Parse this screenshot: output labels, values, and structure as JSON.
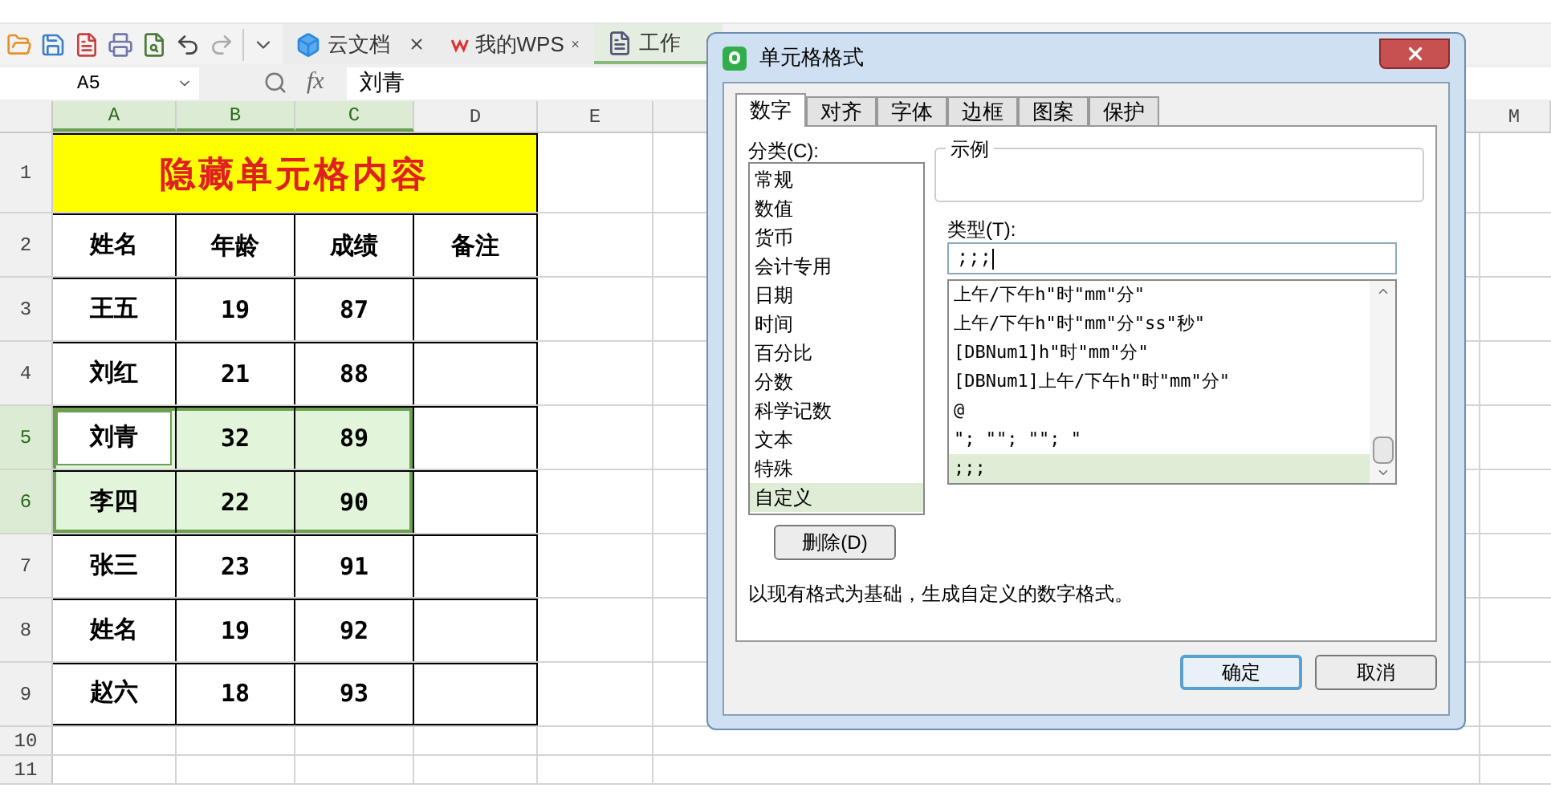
{
  "toolbar": {
    "tabs": [
      {
        "label": "云文档",
        "selected": false,
        "kind": "cloud",
        "closable": true
      },
      {
        "label": "我的WPS",
        "selected": false,
        "kind": "wps",
        "closable": true
      },
      {
        "label": "工作",
        "selected": true,
        "kind": "book",
        "closable": false
      }
    ]
  },
  "formula_bar": {
    "name_box": "A5",
    "fx_label": "fx",
    "value": "刘青"
  },
  "columns": [
    {
      "label": "A",
      "selected": true
    },
    {
      "label": "B",
      "selected": true
    },
    {
      "label": "C",
      "selected": true
    },
    {
      "label": "D",
      "selected": false
    },
    {
      "label": "E",
      "selected": false
    },
    {
      "label": "M",
      "selected": false
    }
  ],
  "rows": [
    {
      "label": "1",
      "selected": false,
      "kind": "title",
      "cells": [
        {
          "text": "隐藏单元格内容"
        }
      ]
    },
    {
      "label": "2",
      "selected": false,
      "kind": "table",
      "cells": [
        {
          "text": "姓名",
          "selected": false,
          "active": false
        },
        {
          "text": "年龄",
          "selected": false,
          "active": false
        },
        {
          "text": "成绩",
          "selected": false,
          "active": false
        },
        {
          "text": "备注",
          "selected": false,
          "active": false
        }
      ]
    },
    {
      "label": "3",
      "selected": false,
      "kind": "table",
      "cells": [
        {
          "text": "王五",
          "selected": false,
          "active": false
        },
        {
          "text": "19",
          "selected": false,
          "active": false
        },
        {
          "text": "87",
          "selected": false,
          "active": false
        }
      ]
    },
    {
      "label": "4",
      "selected": false,
      "kind": "table",
      "cells": [
        {
          "text": "刘红",
          "selected": false,
          "active": false
        },
        {
          "text": "21",
          "selected": false,
          "active": false
        },
        {
          "text": "88",
          "selected": false,
          "active": false
        }
      ]
    },
    {
      "label": "5",
      "selected": true,
      "kind": "table",
      "cells": [
        {
          "text": "刘青",
          "selected": true,
          "active": true
        },
        {
          "text": "32",
          "selected": true,
          "active": false
        },
        {
          "text": "89",
          "selected": true,
          "active": false
        }
      ]
    },
    {
      "label": "6",
      "selected": true,
      "kind": "table",
      "cells": [
        {
          "text": "李四",
          "selected": true,
          "active": false
        },
        {
          "text": "22",
          "selected": true,
          "active": false
        },
        {
          "text": "90",
          "selected": true,
          "active": false
        }
      ]
    },
    {
      "label": "7",
      "selected": false,
      "kind": "table",
      "cells": [
        {
          "text": "张三",
          "selected": false,
          "active": false
        },
        {
          "text": "23",
          "selected": false,
          "active": false
        },
        {
          "text": "91",
          "selected": false,
          "active": false
        }
      ]
    },
    {
      "label": "8",
      "selected": false,
      "kind": "table",
      "cells": [
        {
          "text": "姓名",
          "selected": false,
          "active": false
        },
        {
          "text": "19",
          "selected": false,
          "active": false
        },
        {
          "text": "92",
          "selected": false,
          "active": false
        }
      ]
    },
    {
      "label": "9",
      "selected": false,
      "kind": "table",
      "cells": [
        {
          "text": "赵六",
          "selected": false,
          "active": false
        },
        {
          "text": "18",
          "selected": false,
          "active": false
        },
        {
          "text": "93",
          "selected": false,
          "active": false
        }
      ]
    },
    {
      "label": "10",
      "selected": false,
      "kind": "blank"
    },
    {
      "label": "11",
      "selected": false,
      "kind": "blank"
    }
  ],
  "dialog": {
    "title": "单元格格式",
    "tabs": [
      {
        "label": "数字",
        "selected": true
      },
      {
        "label": "对齐",
        "selected": false
      },
      {
        "label": "字体",
        "selected": false
      },
      {
        "label": "边框",
        "selected": false
      },
      {
        "label": "图案",
        "selected": false
      },
      {
        "label": "保护",
        "selected": false
      }
    ],
    "category_label": "分类(C):",
    "categories": [
      {
        "label": "常规",
        "selected": false
      },
      {
        "label": "数值",
        "selected": false
      },
      {
        "label": "货币",
        "selected": false
      },
      {
        "label": "会计专用",
        "selected": false
      },
      {
        "label": "日期",
        "selected": false
      },
      {
        "label": "时间",
        "selected": false
      },
      {
        "label": "百分比",
        "selected": false
      },
      {
        "label": "分数",
        "selected": false
      },
      {
        "label": "科学记数",
        "selected": false
      },
      {
        "label": "文本",
        "selected": false
      },
      {
        "label": "特殊",
        "selected": false
      },
      {
        "label": "自定义",
        "selected": true
      }
    ],
    "sample_label": "示例",
    "type_label": "类型(T):",
    "type_value": ";;;",
    "formats": [
      {
        "label": "上午/下午h\"时\"mm\"分\"",
        "selected": false
      },
      {
        "label": "上午/下午h\"时\"mm\"分\"ss\"秒\"",
        "selected": false
      },
      {
        "label": "[DBNum1]h\"时\"mm\"分\"",
        "selected": false
      },
      {
        "label": "[DBNum1]上午/下午h\"时\"mm\"分\"",
        "selected": false
      },
      {
        "label": "@",
        "selected": false
      },
      {
        "label": "\"; \"\"; \"\"; \"",
        "selected": false
      },
      {
        "label": ";;;",
        "selected": true
      }
    ],
    "delete_button": "删除(D)",
    "description": "以现有格式为基础，生成自定义的数字格式。",
    "buttons": [
      {
        "label": "确定",
        "kind": "default"
      },
      {
        "label": "取消",
        "kind": "normal"
      }
    ]
  }
}
